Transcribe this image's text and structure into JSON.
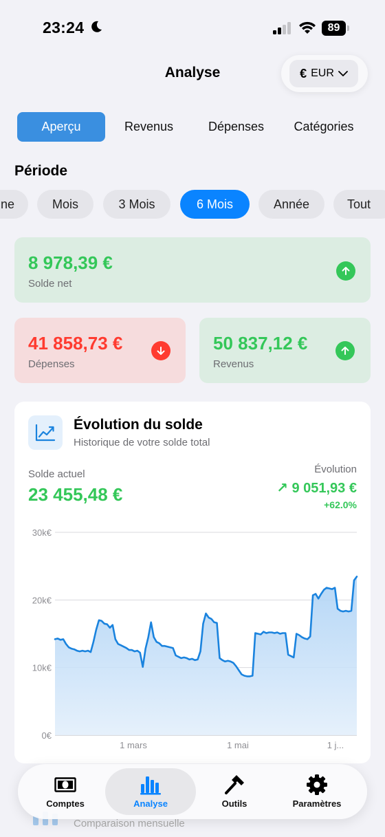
{
  "status_bar": {
    "time": "23:24",
    "battery": "89"
  },
  "header": {
    "title": "Analyse",
    "currency_symbol": "€",
    "currency_code": "EUR"
  },
  "tabs": [
    {
      "label": "Aperçu",
      "active": true
    },
    {
      "label": "Revenus",
      "active": false
    },
    {
      "label": "Dépenses",
      "active": false
    },
    {
      "label": "Catégories",
      "active": false
    }
  ],
  "period": {
    "label": "Période",
    "options": [
      "ne",
      "Mois",
      "3 Mois",
      "6 Mois",
      "Année",
      "Tout"
    ],
    "selected": "6 Mois"
  },
  "summary": {
    "net": {
      "value": "8 978,39 €",
      "label": "Solde net",
      "trend": "up"
    },
    "expenses": {
      "value": "41 858,73 €",
      "label": "Dépenses",
      "trend": "down"
    },
    "income": {
      "value": "50 837,12 €",
      "label": "Revenus",
      "trend": "up"
    }
  },
  "balance_chart": {
    "title": "Évolution du solde",
    "subtitle": "Historique de votre solde total",
    "current_label": "Solde actuel",
    "current_value": "23 455,48 €",
    "evolution_label": "Évolution",
    "evolution_value": "↗ 9 051,93 €",
    "evolution_percent": "+62.0%"
  },
  "chart_data": {
    "type": "area",
    "title": "Évolution du solde",
    "ylim": [
      0,
      30000
    ],
    "y_ticks": [
      "0€",
      "10k€",
      "20k€",
      "30k€"
    ],
    "x_ticks": [
      "1 mars",
      "1 mai",
      "1 j..."
    ],
    "grid": true,
    "series": [
      {
        "values": [
          14200,
          14300,
          14100,
          14200,
          13500,
          13000,
          12800,
          12700,
          12500,
          12400,
          12500,
          12400,
          12500,
          12300,
          13800,
          15600,
          17000,
          16900,
          16500,
          16400,
          15900,
          16300,
          14200,
          13500,
          13300,
          13100,
          12900,
          12600,
          12600,
          12400,
          12500,
          12200,
          10100,
          12800,
          14500,
          16700,
          14500,
          13800,
          13600,
          13200,
          13200,
          13100,
          13000,
          12900,
          11800,
          11600,
          11400,
          11500,
          11400,
          11200,
          11300,
          11100,
          11200,
          12400,
          16500,
          18000,
          17400,
          17200,
          16700,
          16600,
          11400,
          11100,
          10900,
          11000,
          10900,
          10700,
          10200,
          9600,
          9000,
          8800,
          8700,
          8700,
          8800,
          15100,
          15000,
          14900,
          15300,
          15100,
          15200,
          15200,
          15100,
          15200,
          15000,
          15100,
          15100,
          11900,
          11700,
          11500,
          15000,
          14800,
          14500,
          14300,
          14200,
          14600,
          20700,
          20900,
          20200,
          20900,
          21500,
          21800,
          21700,
          21600,
          21800,
          18700,
          18400,
          18300,
          18400,
          18300,
          18400,
          22900,
          23455
        ]
      }
    ]
  },
  "behind_content": {
    "subtitle": "Comparaison mensuelle"
  },
  "tabbar": [
    {
      "label": "Comptes",
      "icon": "banknote-icon",
      "active": false
    },
    {
      "label": "Analyse",
      "icon": "bar-chart-icon",
      "active": true
    },
    {
      "label": "Outils",
      "icon": "hammer-icon",
      "active": false
    },
    {
      "label": "Paramètres",
      "icon": "gear-icon",
      "active": false
    }
  ],
  "colors": {
    "accent": "#0a84ff",
    "positive": "#34c759",
    "negative": "#ff3b30",
    "chart_line": "#1a83de"
  }
}
